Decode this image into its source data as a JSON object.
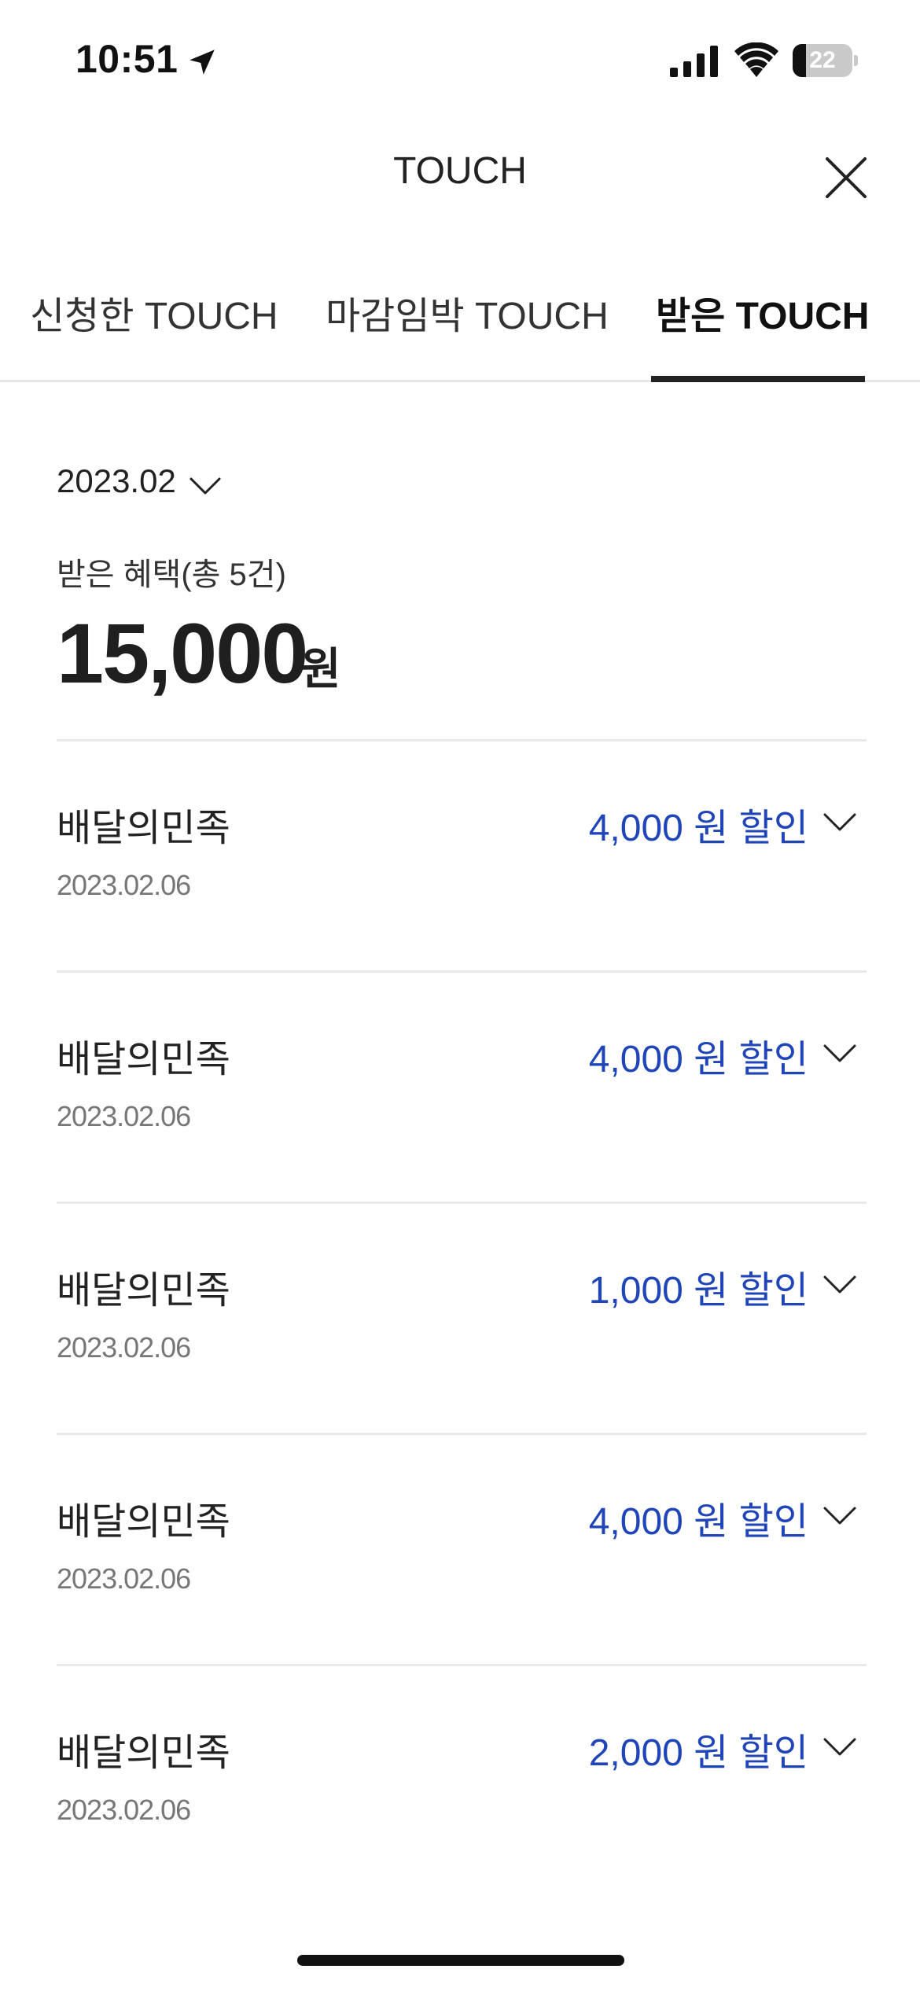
{
  "status_bar": {
    "time": "10:51",
    "battery_level": "22",
    "battery_fraction": 0.22
  },
  "header": {
    "title": "TOUCH",
    "close_icon": "close-icon"
  },
  "tabs": [
    {
      "label": "신청한 TOUCH",
      "active": false
    },
    {
      "label": "마감임박 TOUCH",
      "active": false
    },
    {
      "label": "받은 TOUCH",
      "active": true
    }
  ],
  "summary": {
    "month": "2023.02",
    "label": "받은 혜택(총 5건)",
    "amount": "15,000",
    "unit": "원"
  },
  "benefits": [
    {
      "merchant": "배달의민족",
      "date": "2023.02.06",
      "amount": "4,000 원 할인"
    },
    {
      "merchant": "배달의민족",
      "date": "2023.02.06",
      "amount": "4,000 원 할인"
    },
    {
      "merchant": "배달의민족",
      "date": "2023.02.06",
      "amount": "1,000 원 할인"
    },
    {
      "merchant": "배달의민족",
      "date": "2023.02.06",
      "amount": "4,000 원 할인"
    },
    {
      "merchant": "배달의민족",
      "date": "2023.02.06",
      "amount": "2,000 원 할인"
    }
  ],
  "colors": {
    "accent_blue": "#1f45b8",
    "text_primary": "#222222",
    "text_secondary": "#777777",
    "divider": "#e8e8e8"
  }
}
